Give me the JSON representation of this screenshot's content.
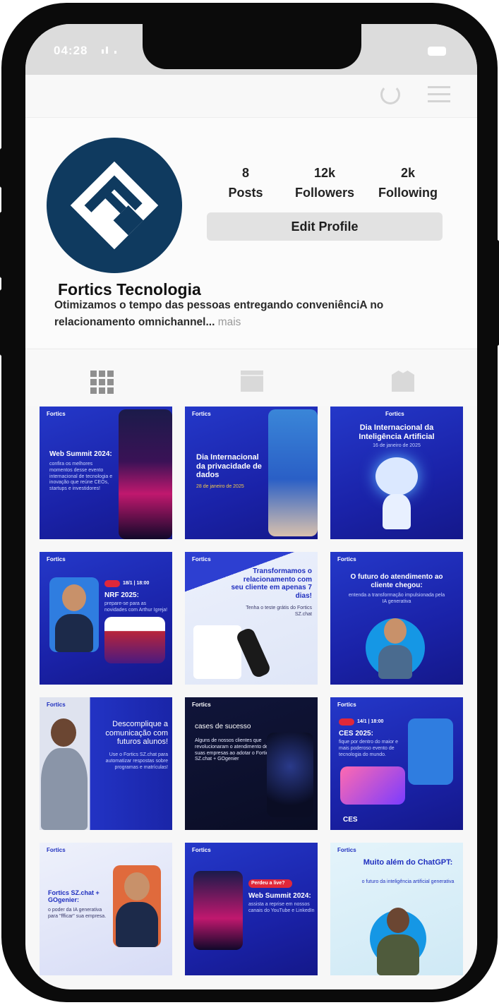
{
  "status_bar": {
    "time": "04:28"
  },
  "profile": {
    "name": "Fortics Tecnologia",
    "bio": "Otimizamos o tempo das pessoas entregando conveniênciA no relacionamento omnichannel...",
    "bio_more": "mais",
    "stats": [
      {
        "value": "8",
        "label": "Posts"
      },
      {
        "value": "12k",
        "label": "Followers"
      },
      {
        "value": "2k",
        "label": "Following"
      }
    ],
    "edit_label": "Edit Profile"
  },
  "posts": [
    {
      "brand": "Fortics",
      "title": "Web Summit 2024:",
      "sub": "confira os melhores momentos desse evento internacional de tecnologia e inovação que reúne CEOs, startups e investidores!"
    },
    {
      "brand": "Fortics",
      "title": "Dia Internacional da privacidade de dados",
      "sub": "28 de janeiro de 2025"
    },
    {
      "brand": "Fortics",
      "title": "Dia Internacional da Inteligência Artificial",
      "sub": "16 de janeiro de 2025"
    },
    {
      "brand": "Fortics",
      "title": "NRF 2025:",
      "sub": "prepare-se para as novidades com Arthur Igreja!",
      "badge": "18/1 | 18:00"
    },
    {
      "brand": "Fortics",
      "title": "Transformamos o relacionamento com seu cliente em apenas 7 dias!",
      "sub": "Tenha o teste grátis do Fortics SZ.chat"
    },
    {
      "brand": "Fortics",
      "title": "O futuro do atendimento ao cliente chegou:",
      "sub": "entenda a transformação impulsionada pela IA generativa"
    },
    {
      "brand": "Fortics",
      "title": "Descomplique a comunicação com futuros alunos!",
      "sub": "Use o Fortics SZ.chat para automatizar respostas sobre programas e matrículas!"
    },
    {
      "brand": "Fortics",
      "title": "cases de sucesso",
      "sub": "Alguns de nossos clientes que revolucionaram o atendimento de suas empresas ao adotar o Fortics SZ.chat + GOgenier"
    },
    {
      "brand": "Fortics",
      "title": "CES 2025:",
      "sub": "fique por dentro do maior e mais poderoso evento de tecnologia do mundo.",
      "badge": "14/1 | 18:00",
      "footer": "CES"
    },
    {
      "brand": "Fortics",
      "title": "Fortics SZ.chat + GOgenier:",
      "sub": "o poder da IA generativa para \"ffficar\" sua empresa."
    },
    {
      "brand": "Fortics",
      "title": "Web Summit 2024:",
      "sub": "assista a reprise em nossos canais do YouTube e LinkedIn",
      "badge": "Perdeu a live?"
    },
    {
      "brand": "Fortics",
      "title": "Muito além do ChatGPT:",
      "sub": "o futuro da inteligência artificial generativa"
    }
  ],
  "colors": {
    "brand_navy": "#0f3a5f",
    "post_blue": "#1f2fbf",
    "accent_red": "#e0283a"
  }
}
